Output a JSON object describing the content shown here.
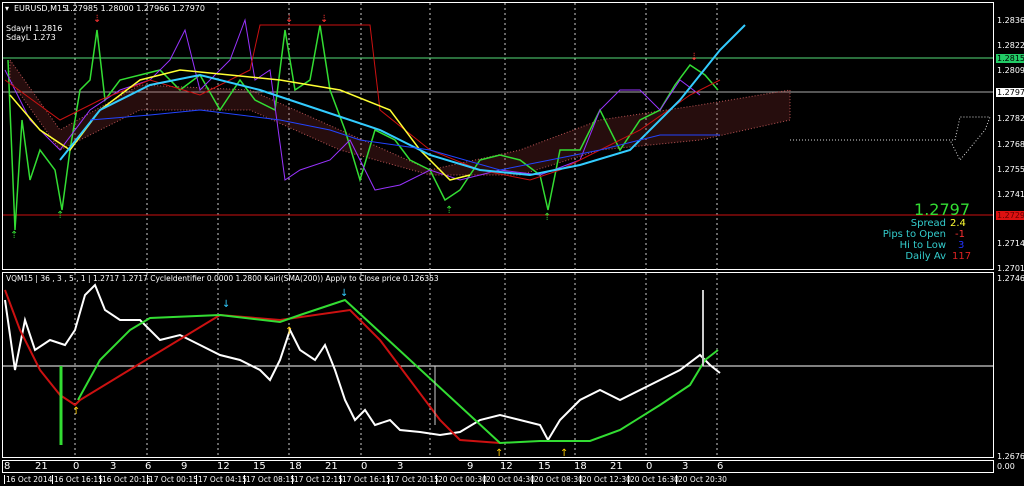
{
  "header": {
    "symbol": "EURUSD,M15",
    "ohlc": "1.27985 1.28000 1.27966 1.27970",
    "menu_icon": "triangle-down-icon"
  },
  "levels": {
    "sdayh": "SdayH 1.2816",
    "sdayl": "SdayL 1.273"
  },
  "price_axis": [
    "1.28360",
    "1.28225",
    "1.28090",
    "1.27820",
    "1.27685",
    "1.27550",
    "1.27415",
    "1.27145",
    "1.27010"
  ],
  "price_tags": {
    "green": "1.28158",
    "white": "1.27970",
    "red": "1.27299"
  },
  "info": {
    "price": "1.2797",
    "spread_label": "Spread",
    "spread": "2.4",
    "pips_label": "Pips to Open",
    "pips": "-1",
    "hilo_label": "Hi to Low",
    "hilo": "3",
    "daily_label": "Daily Av",
    "daily": "117"
  },
  "sub": {
    "label": "VQM15 | 36 , 3 , 5 , 1  |  1.2717 1.2717  CycleIdentifier 0.0000 1.2800  Kairi(SMA(200)) Apply to Close price 0.126353",
    "axis_top": "1.2746",
    "axis_bottom": "1.2676",
    "axis_zero": "0.00"
  },
  "time_axis": [
    "8",
    "21",
    "0",
    "3",
    "6",
    "9",
    "12",
    "15",
    "18",
    "21",
    "0",
    "3",
    "9",
    "12",
    "15",
    "18",
    "21",
    "0",
    "3",
    "6"
  ],
  "dates": [
    "16 Oct 2014",
    "16 Oct 16:15",
    "16 Oct 20:15",
    "17 Oct 00:15",
    "17 Oct 04:15",
    "17 Oct 08:15",
    "17 Oct 12:15",
    "17 Oct 16:15",
    "17 Oct 20:15",
    "20 Oct 00:30",
    "20 Oct 04:30",
    "20 Oct 08:30",
    "20 Oct 12:30",
    "20 Oct 16:30",
    "20 Oct 20:30"
  ],
  "colors": {
    "up": "#33dd33",
    "ma_yellow": "#ffff33",
    "ma_cyan": "#33ccff",
    "purple": "#9933ff",
    "red": "#cc1111"
  }
}
